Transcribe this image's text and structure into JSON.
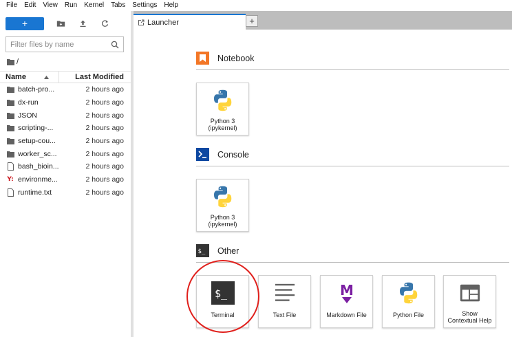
{
  "menu": [
    "File",
    "Edit",
    "View",
    "Run",
    "Kernel",
    "Tabs",
    "Settings",
    "Help"
  ],
  "toolbar": {
    "new_label": "+",
    "icons": [
      "new-folder-icon",
      "upload-icon",
      "refresh-icon"
    ]
  },
  "filter": {
    "placeholder": "Filter files by name"
  },
  "breadcrumb": "/",
  "table": {
    "col_name": "Name",
    "col_modified": "Last Modified",
    "rows": [
      {
        "name": "batch-pro...",
        "modified": "2 hours ago",
        "icon": "folder-icon"
      },
      {
        "name": "dx-run",
        "modified": "2 hours ago",
        "icon": "folder-icon"
      },
      {
        "name": "JSON",
        "modified": "2 hours ago",
        "icon": "folder-icon"
      },
      {
        "name": "scripting-...",
        "modified": "2 hours ago",
        "icon": "folder-icon"
      },
      {
        "name": "setup-cou...",
        "modified": "2 hours ago",
        "icon": "folder-icon"
      },
      {
        "name": "worker_sc...",
        "modified": "2 hours ago",
        "icon": "folder-icon"
      },
      {
        "name": "bash_bioin...",
        "modified": "2 hours ago",
        "icon": "file-icon"
      },
      {
        "name": "environme...",
        "modified": "2 hours ago",
        "icon": "yaml-icon"
      },
      {
        "name": "runtime.txt",
        "modified": "2 hours ago",
        "icon": "file-icon"
      }
    ]
  },
  "yaml_glyph": "Y:",
  "tab": {
    "label": "Launcher",
    "add": "+"
  },
  "launcher": {
    "notebook": {
      "title": "Notebook",
      "cards": [
        {
          "line1": "Python 3",
          "line2": "(ipykernel)"
        }
      ]
    },
    "console": {
      "title": "Console",
      "cards": [
        {
          "line1": "Python 3",
          "line2": "(ipykernel)"
        }
      ]
    },
    "other": {
      "title": "Other",
      "cards": [
        {
          "line1": "Terminal",
          "line2": ""
        },
        {
          "line1": "Text File",
          "line2": ""
        },
        {
          "line1": "Markdown File",
          "line2": ""
        },
        {
          "line1": "Python File",
          "line2": ""
        },
        {
          "line1": "Show",
          "line2": "Contextual Help"
        }
      ]
    }
  },
  "colors": {
    "accent": "#1976d2",
    "notebook": "#f37626",
    "console": "#0d47a1",
    "markdown": "#7b1fa2",
    "annotation": "#e0201c"
  }
}
